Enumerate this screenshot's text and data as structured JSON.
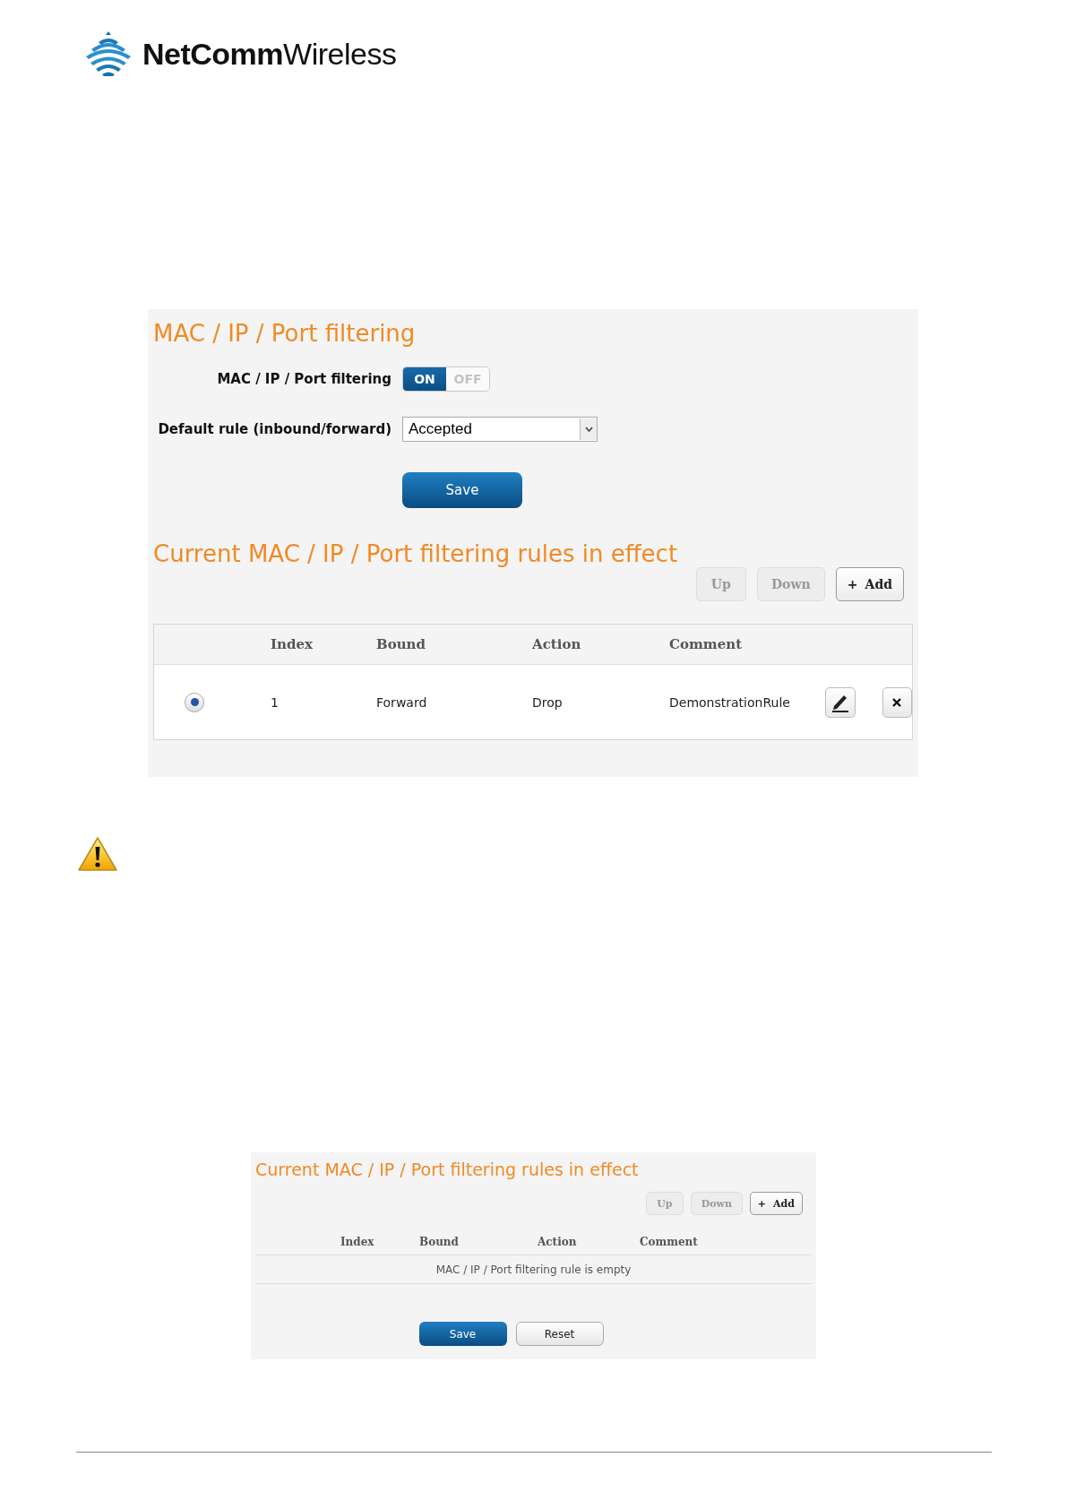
{
  "logo": {
    "text": "**NetComm**Wireless"
  },
  "filter_panel": {
    "title": "MAC / IP / Port filtering",
    "toggle": {
      "label": "MAC / IP / Port filtering",
      "on_text": "ON",
      "off_text": "OFF",
      "on": true
    },
    "default_rule": {
      "label": "Default rule (inbound/forward)",
      "value": "Accepted"
    },
    "save_button": "Save"
  },
  "rules_panel": {
    "title": "Current MAC / IP / Port filtering rules in effect",
    "buttons": [
      {
        "label": "Up",
        "disabled": true
      },
      {
        "label": "Down",
        "disabled": true
      },
      {
        "label": "Add",
        "icon_text": "+",
        "disabled": false
      }
    ],
    "columns": [
      "Index",
      "Bound",
      "Action",
      "Comment"
    ],
    "rows": [
      {
        "selected": true,
        "cells": [
          "1",
          "Forward",
          "Drop",
          "DemonstrationRule"
        ]
      }
    ]
  },
  "empty_rules_panel": {
    "title": "Current MAC / IP / Port filtering rules in effect",
    "buttons": [
      {
        "label": "Up",
        "disabled": true
      },
      {
        "label": "Down",
        "disabled": true
      },
      {
        "label": "Add",
        "icon_text": "+",
        "disabled": false
      }
    ],
    "columns": [
      "Index",
      "Bound",
      "Action",
      "Comment"
    ],
    "empty_message": "MAC / IP / Port filtering rule is empty",
    "save_button": "Save",
    "reset_button": "Reset"
  }
}
